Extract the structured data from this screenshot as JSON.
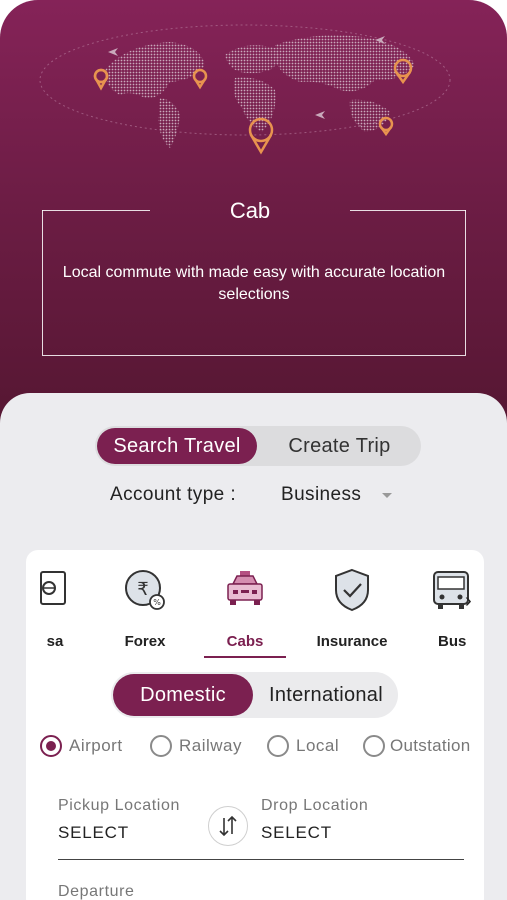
{
  "hero": {
    "title": "Cab",
    "description": "Local commute with made easy with accurate location selections"
  },
  "mode_toggle": {
    "active": "Search Travel",
    "inactive": "Create Trip"
  },
  "account": {
    "label": "Account type :",
    "value": "Business"
  },
  "categories": [
    {
      "label": "sa",
      "icon": "visa-icon"
    },
    {
      "label": "Forex",
      "icon": "forex-icon"
    },
    {
      "label": "Cabs",
      "icon": "cab-icon",
      "selected": true
    },
    {
      "label": "Insurance",
      "icon": "insurance-icon"
    },
    {
      "label": "Bus",
      "icon": "bus-icon"
    }
  ],
  "trip_scope": {
    "active": "Domestic",
    "inactive": "International"
  },
  "trip_types": [
    {
      "label": "Airport",
      "selected": true
    },
    {
      "label": "Railway",
      "selected": false
    },
    {
      "label": "Local",
      "selected": false
    },
    {
      "label": "Outstation",
      "selected": false
    }
  ],
  "pickup": {
    "label": "Pickup Location",
    "value": "SELECT"
  },
  "drop": {
    "label": "Drop Location",
    "value": "SELECT"
  },
  "departure": {
    "label": "Departure"
  },
  "colors": {
    "brand": "#7b2050",
    "hero_top": "#852358",
    "hero_bottom": "#541631",
    "pin": "#e8934f",
    "sheet": "#ececef"
  }
}
